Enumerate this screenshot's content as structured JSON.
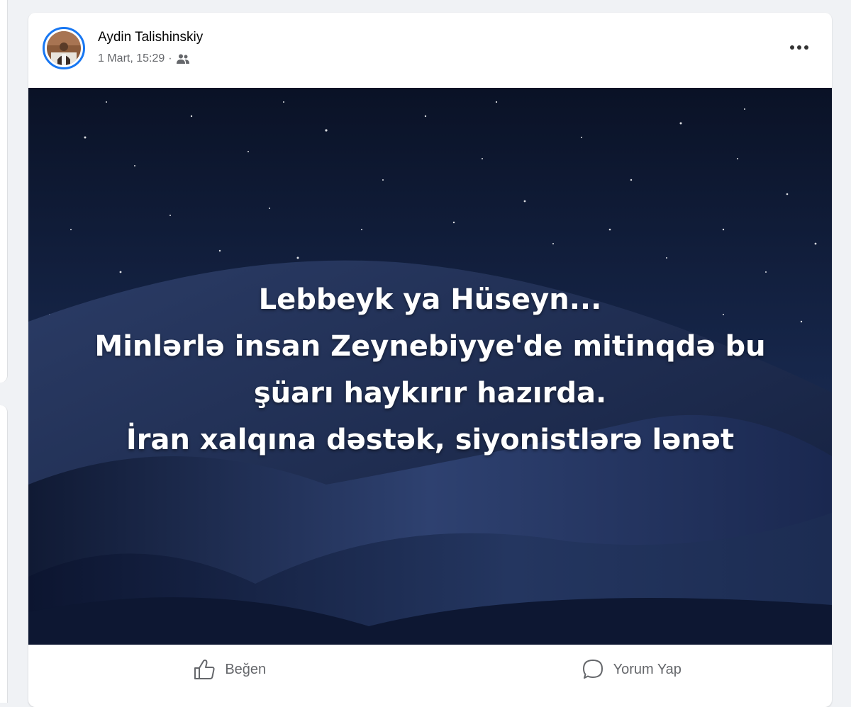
{
  "post": {
    "author_name": "Aydin Talishinskiy",
    "timestamp": "1 Mart, 15:29",
    "separator": "·",
    "audience_icon": "friends-icon",
    "more_icon": "more-options-icon",
    "image_text_lines": [
      "Lebbeyk ya Hüseyn...",
      "Minlərlə insan Zeynebiyye'de mitinqdə bu",
      "şüarı haykırır hazırda.",
      "İran xalqına dəstək, siyonistlərə lənət"
    ]
  },
  "actions": {
    "like_label": "Beğen",
    "like_icon": "thumbs-up-icon",
    "comment_label": "Yorum Yap",
    "comment_icon": "comment-bubble-icon"
  },
  "colors": {
    "accent": "#1877f2",
    "secondary_text": "#65676b",
    "image_background": "#0b1730"
  }
}
